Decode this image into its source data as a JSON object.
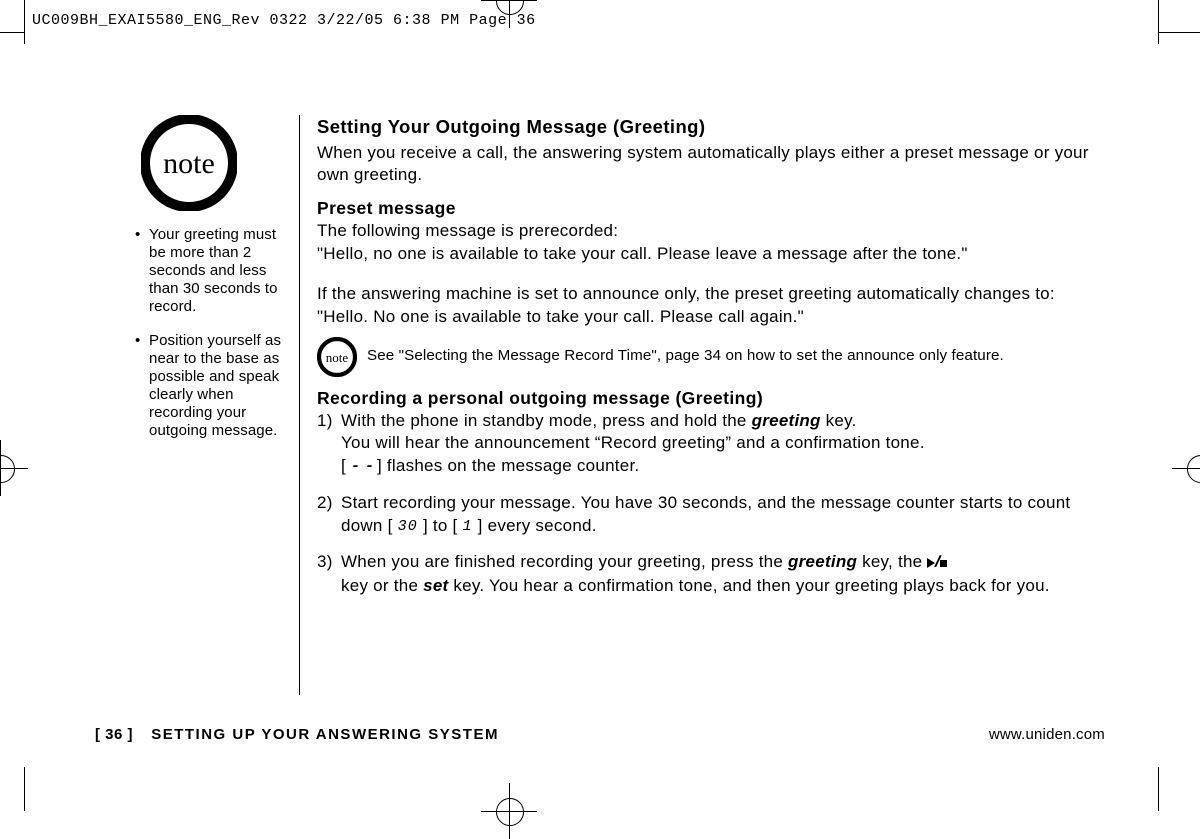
{
  "header_print_tag": "UC009BH_EXAI5580_ENG_Rev 0322  3/22/05  6:38 PM  Page 36",
  "sidebar": {
    "bullets": [
      "Your greeting must be more than 2 seconds and less than 30 seconds to record.",
      "Position yourself as near to the base as possible and speak clearly when recording your outgoing message."
    ]
  },
  "main": {
    "h1": "Setting Your Outgoing Message (Greeting)",
    "intro": "When you receive a call, the answering system automatically plays either a preset message or your own greeting.",
    "preset_h": "Preset message",
    "preset_1": "The following message is prerecorded:",
    "preset_2": "\"Hello, no one is available to take your call. Please leave a message after the tone.\"",
    "preset_3": "If the answering machine is set to announce only, the preset greeting automatically changes to:",
    "preset_4": "\"Hello. No one is available to take your call. Please call again.\"",
    "inline_note": "See \"Selecting the Message Record Time\", page 34 on how to set the announce only feature.",
    "rec_h": "Recording a personal outgoing message (Greeting)",
    "steps": {
      "s1a": "With the phone in standby mode, press and hold the ",
      "s1k": "greeting",
      "s1b": " key.",
      "s1c": "You will hear the announcement “Record greeting” and a confirmation tone.",
      "s1d_pre": "[ ",
      "s1d_post": " ] flashes on the message counter.",
      "s2a": "Start recording your message. You have 30 seconds, and the message counter starts to count down [ ",
      "s2_30": "30",
      "s2_mid": " ] to [ ",
      "s2_1": "1",
      "s2b": " ] every second.",
      "s3a": "When you are finished recording your greeting, press the ",
      "s3k1": "greeting",
      "s3b": " key, the  ",
      "s3c": "key or the ",
      "s3k2": "set",
      "s3d": " key. You hear a confirmation tone, and then your greeting plays back for you."
    }
  },
  "footer": {
    "page": "[ 36 ]",
    "section": "SETTING UP YOUR ANSWERING SYSTEM",
    "url": "www.uniden.com"
  }
}
